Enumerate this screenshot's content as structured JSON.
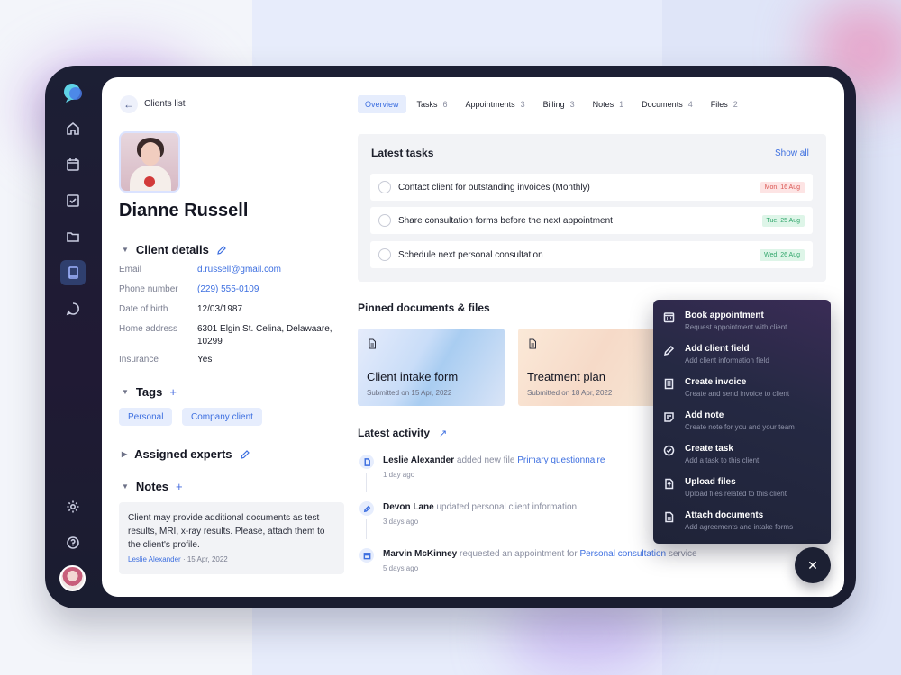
{
  "nav": {
    "back_label": "Clients list"
  },
  "client": {
    "name": "Dianne Russell",
    "details_title": "Client details",
    "fields": [
      {
        "label": "Email",
        "value": "d.russell@gmail.com"
      },
      {
        "label": "Phone number",
        "value": "(229) 555-0109"
      },
      {
        "label": "Date of birth",
        "value": "12/03/1987"
      },
      {
        "label": "Home address",
        "value": "6301 Elgin St. Celina, Delawaare, 10299"
      },
      {
        "label": "Insurance",
        "value": "Yes"
      }
    ],
    "tags_title": "Tags",
    "tags": [
      "Personal",
      "Company client"
    ],
    "experts_title": "Assigned experts",
    "notes_title": "Notes",
    "note": {
      "text": "Client may provide additional documents as test results, MRI, x-ray results. Please, attach them to the client's profile.",
      "author": "Leslie Alexander",
      "date": "15 Apr, 2022"
    }
  },
  "tabs": [
    {
      "label": "Overview",
      "count": ""
    },
    {
      "label": "Tasks",
      "count": "6"
    },
    {
      "label": "Appointments",
      "count": "3"
    },
    {
      "label": "Billing",
      "count": "3"
    },
    {
      "label": "Notes",
      "count": "1"
    },
    {
      "label": "Documents",
      "count": "4"
    },
    {
      "label": "Files",
      "count": "2"
    }
  ],
  "tasks": {
    "title": "Latest tasks",
    "show_all": "Show all",
    "items": [
      {
        "text": "Contact client for outstanding invoices (Monthly)",
        "date": "Mon, 16 Aug"
      },
      {
        "text": "Share consultation forms before the next appointment",
        "date": "Tue, 25 Aug"
      },
      {
        "text": "Schedule next personal consultation",
        "date": "Wed, 26 Aug"
      }
    ]
  },
  "pinned": {
    "title": "Pinned documents & files",
    "docs": [
      {
        "title": "Client intake form",
        "sub": "Submitted on 15 Apr, 2022"
      },
      {
        "title": "Treatment plan",
        "sub": "Submitted on 18 Apr, 2022"
      }
    ]
  },
  "activity": {
    "title": "Latest activity",
    "items": [
      {
        "actor": "Leslie Alexander",
        "action": " added new file ",
        "target": "Primary questionnaire",
        "tail": "",
        "time": "1 day ago"
      },
      {
        "actor": "Devon Lane",
        "action": " updated personal client information",
        "target": "",
        "tail": "",
        "time": "3 days ago"
      },
      {
        "actor": "Marvin McKinney",
        "action": " requested an appointment for ",
        "target": "Personal consultation",
        "tail": " service",
        "time": "5 days ago"
      }
    ]
  },
  "menu": [
    {
      "title": "Book appointment",
      "sub": "Request appointment with client",
      "icon": "calendar-icon"
    },
    {
      "title": "Add client field",
      "sub": "Add client information field",
      "icon": "pencil-icon"
    },
    {
      "title": "Create invoice",
      "sub": "Create and send invoice to client",
      "icon": "invoice-icon"
    },
    {
      "title": "Add note",
      "sub": "Create note for you and your team",
      "icon": "note-icon"
    },
    {
      "title": "Create task",
      "sub": "Add a task to this client",
      "icon": "check-circle-icon"
    },
    {
      "title": "Upload files",
      "sub": "Upload files related to this client",
      "icon": "upload-file-icon"
    },
    {
      "title": "Attach documents",
      "sub": "Add agreements and intake forms",
      "icon": "document-icon"
    }
  ],
  "colors": {
    "accent": "#3d6fe0",
    "rail": "#1c1f34",
    "badge_red": "#d9534f",
    "badge_green": "#2fa56a"
  }
}
